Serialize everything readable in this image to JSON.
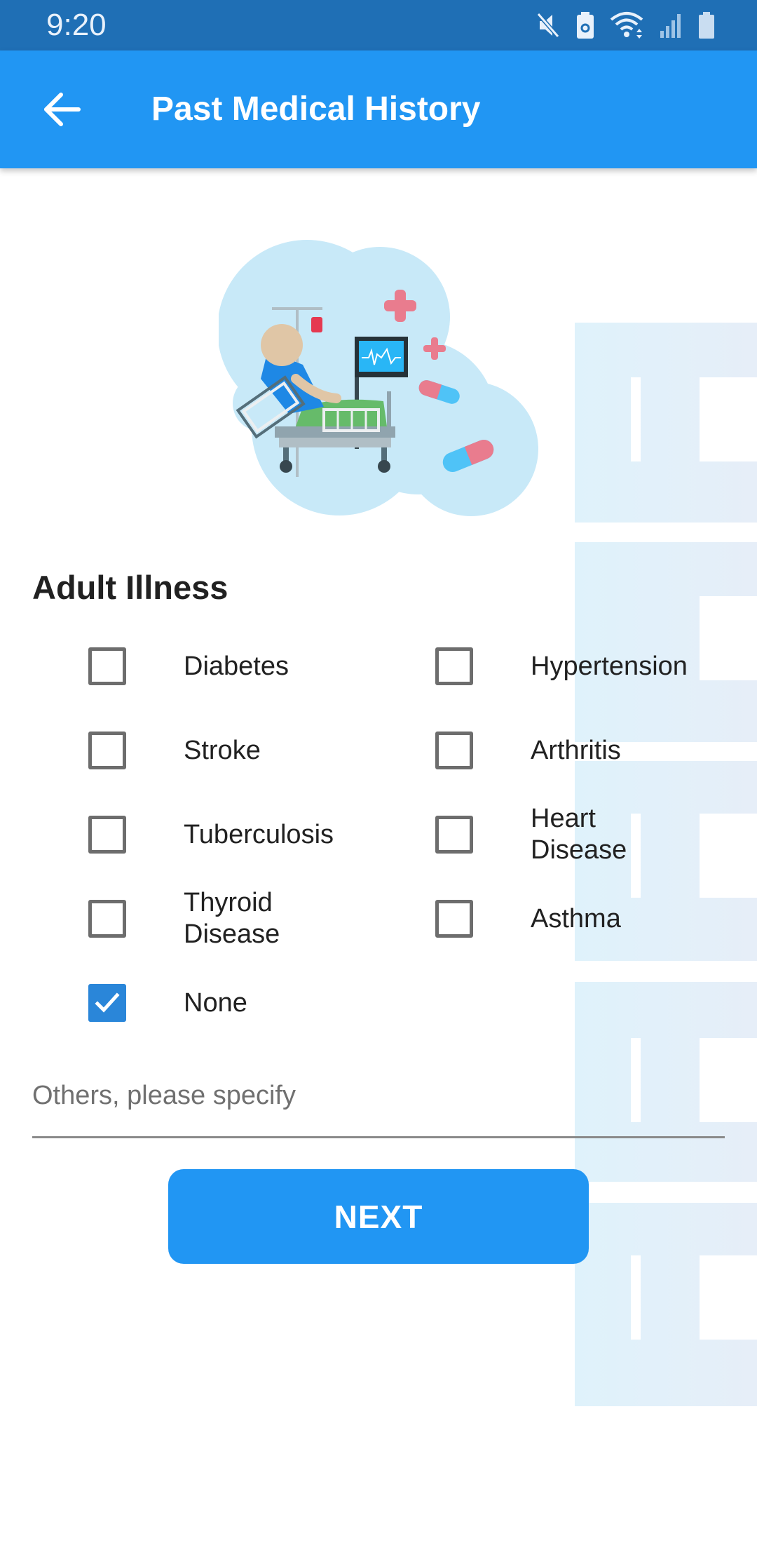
{
  "status_bar": {
    "time": "9:20",
    "icons": [
      "mute-icon",
      "battery-saver-icon",
      "wifi-icon",
      "signal-icon",
      "battery-icon"
    ]
  },
  "app_bar": {
    "title": "Past Medical History",
    "back_icon": "arrow-left-icon"
  },
  "section": {
    "title": "Adult Illness"
  },
  "options": [
    {
      "label": "Diabetes",
      "checked": false
    },
    {
      "label": "Hypertension",
      "checked": false
    },
    {
      "label": "Stroke",
      "checked": false
    },
    {
      "label": "Arthritis",
      "checked": false
    },
    {
      "label": "Tuberculosis",
      "checked": false
    },
    {
      "label": "Heart Disease",
      "checked": false
    },
    {
      "label": "Thyroid Disease",
      "checked": false
    },
    {
      "label": "Asthma",
      "checked": false
    },
    {
      "label": "None",
      "checked": true
    }
  ],
  "others_field": {
    "placeholder": "Others, please specify",
    "value": ""
  },
  "next_button": {
    "label": "NEXT"
  },
  "colors": {
    "primary": "#2196f3",
    "status_bar": "#1f6fb5",
    "checkbox_checked": "#2a86d9",
    "checkbox_border": "#6d6d6d"
  }
}
